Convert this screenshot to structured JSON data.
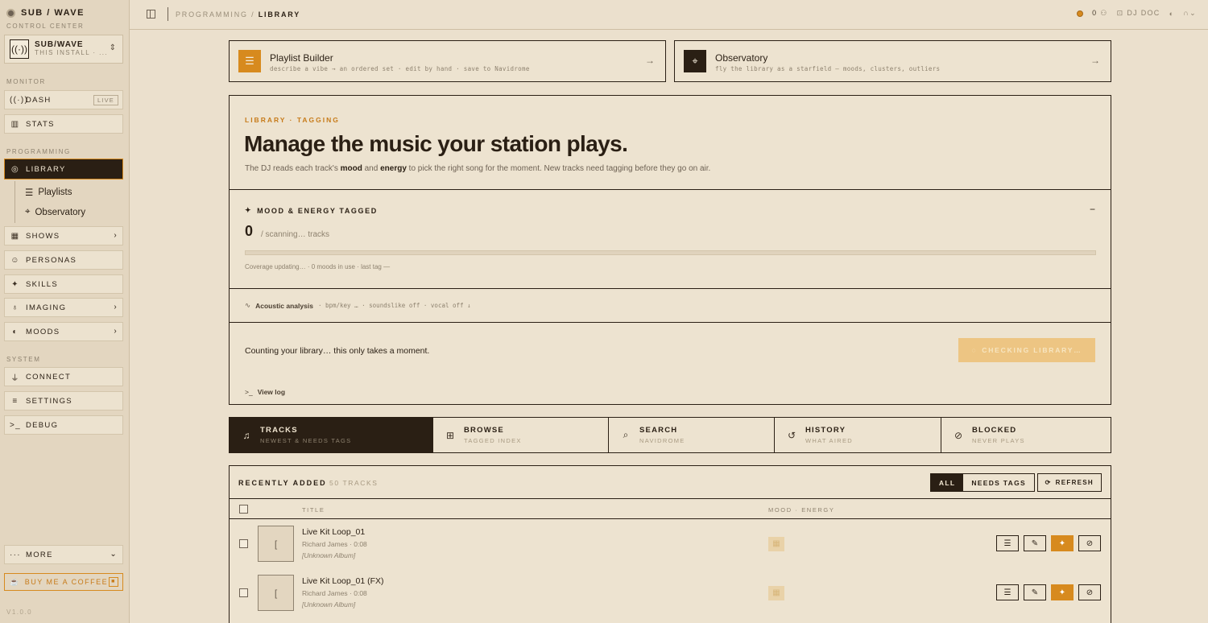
{
  "brand": {
    "name": "SUB / WAVE",
    "subtitle": "CONTROL CENTER"
  },
  "install": {
    "name": "SUB/WAVE",
    "sub": "THIS INSTALL · ..."
  },
  "sidebar": {
    "sections": {
      "monitor": "MONITOR",
      "programming": "PROGRAMMING",
      "system": "SYSTEM"
    },
    "dash": {
      "label": "DASH",
      "badge": "LIVE"
    },
    "stats": "STATS",
    "library": "LIBRARY",
    "playlists": "Playlists",
    "observatory": "Observatory",
    "shows": "SHOWS",
    "personas": "PERSONAS",
    "skills": "SKILLS",
    "imaging": "IMAGING",
    "moods": "MOODS",
    "connect": "CONNECT",
    "settings": "SETTINGS",
    "debug": "DEBUG",
    "more": "MORE",
    "coffee": "BUY ME A COFFEE",
    "version": "V1.0.0"
  },
  "topbar": {
    "crumb_parent": "PROGRAMMING",
    "crumb_sep": "/",
    "crumb_current": "LIBRARY",
    "listeners": "0",
    "dj": "DJ DOC"
  },
  "quicklinks": {
    "builder": {
      "title": "Playlist Builder",
      "sub": "describe a vibe → an ordered set · edit by hand · save to Navidrome"
    },
    "observatory": {
      "title": "Observatory",
      "sub": "fly the library as a starfield — moods, clusters, outliers"
    }
  },
  "hero": {
    "eyebrow": "LIBRARY · TAGGING",
    "headline": "Manage the music your station plays.",
    "lede_a": "The DJ reads each track's ",
    "lede_mood": "mood",
    "lede_and": " and ",
    "lede_energy": "energy",
    "lede_b": " to pick the right song for the moment. New tracks need tagging before they go on air."
  },
  "tagged": {
    "title": "MOOD & ENERGY TAGGED",
    "collapse": "−",
    "count": "0",
    "count_sub": "/ scanning… tracks",
    "progress": 0,
    "coverage": "Coverage updating… · 0 moods in use · last tag —"
  },
  "acoustic": {
    "label": "Acoustic analysis",
    "detail": "· bpm/key … · soundslike off · vocal off ↓"
  },
  "library_check": {
    "message": "Counting your library… this only takes a moment.",
    "button": "CHECKING LIBRARY…"
  },
  "viewlog": "View log",
  "tabs": [
    {
      "label": "TRACKS",
      "sub": "NEWEST & NEEDS TAGS"
    },
    {
      "label": "BROWSE",
      "sub": "TAGGED INDEX"
    },
    {
      "label": "SEARCH",
      "sub": "NAVIDROME"
    },
    {
      "label": "HISTORY",
      "sub": "WHAT AIRED"
    },
    {
      "label": "BLOCKED",
      "sub": "NEVER PLAYS"
    }
  ],
  "tracks": {
    "title": "RECENTLY ADDED",
    "count": "50 TRACKS",
    "filter_all": "ALL",
    "filter_needs": "NEEDS TAGS",
    "refresh": "REFRESH",
    "col_title": "TITLE",
    "col_mood": "MOOD · ENERGY",
    "rows": [
      {
        "title": "Live Kit Loop_01",
        "meta": "Richard James · 0:08",
        "album": "[Unknown Album]",
        "thumb": "["
      },
      {
        "title": "Live Kit Loop_01 (FX)",
        "meta": "Richard James · 0:08",
        "album": "[Unknown Album]",
        "thumb": "["
      }
    ]
  },
  "colors": {
    "accent": "#d78a1e",
    "ink": "#2a1f14",
    "paper": "#ebe0cd"
  }
}
